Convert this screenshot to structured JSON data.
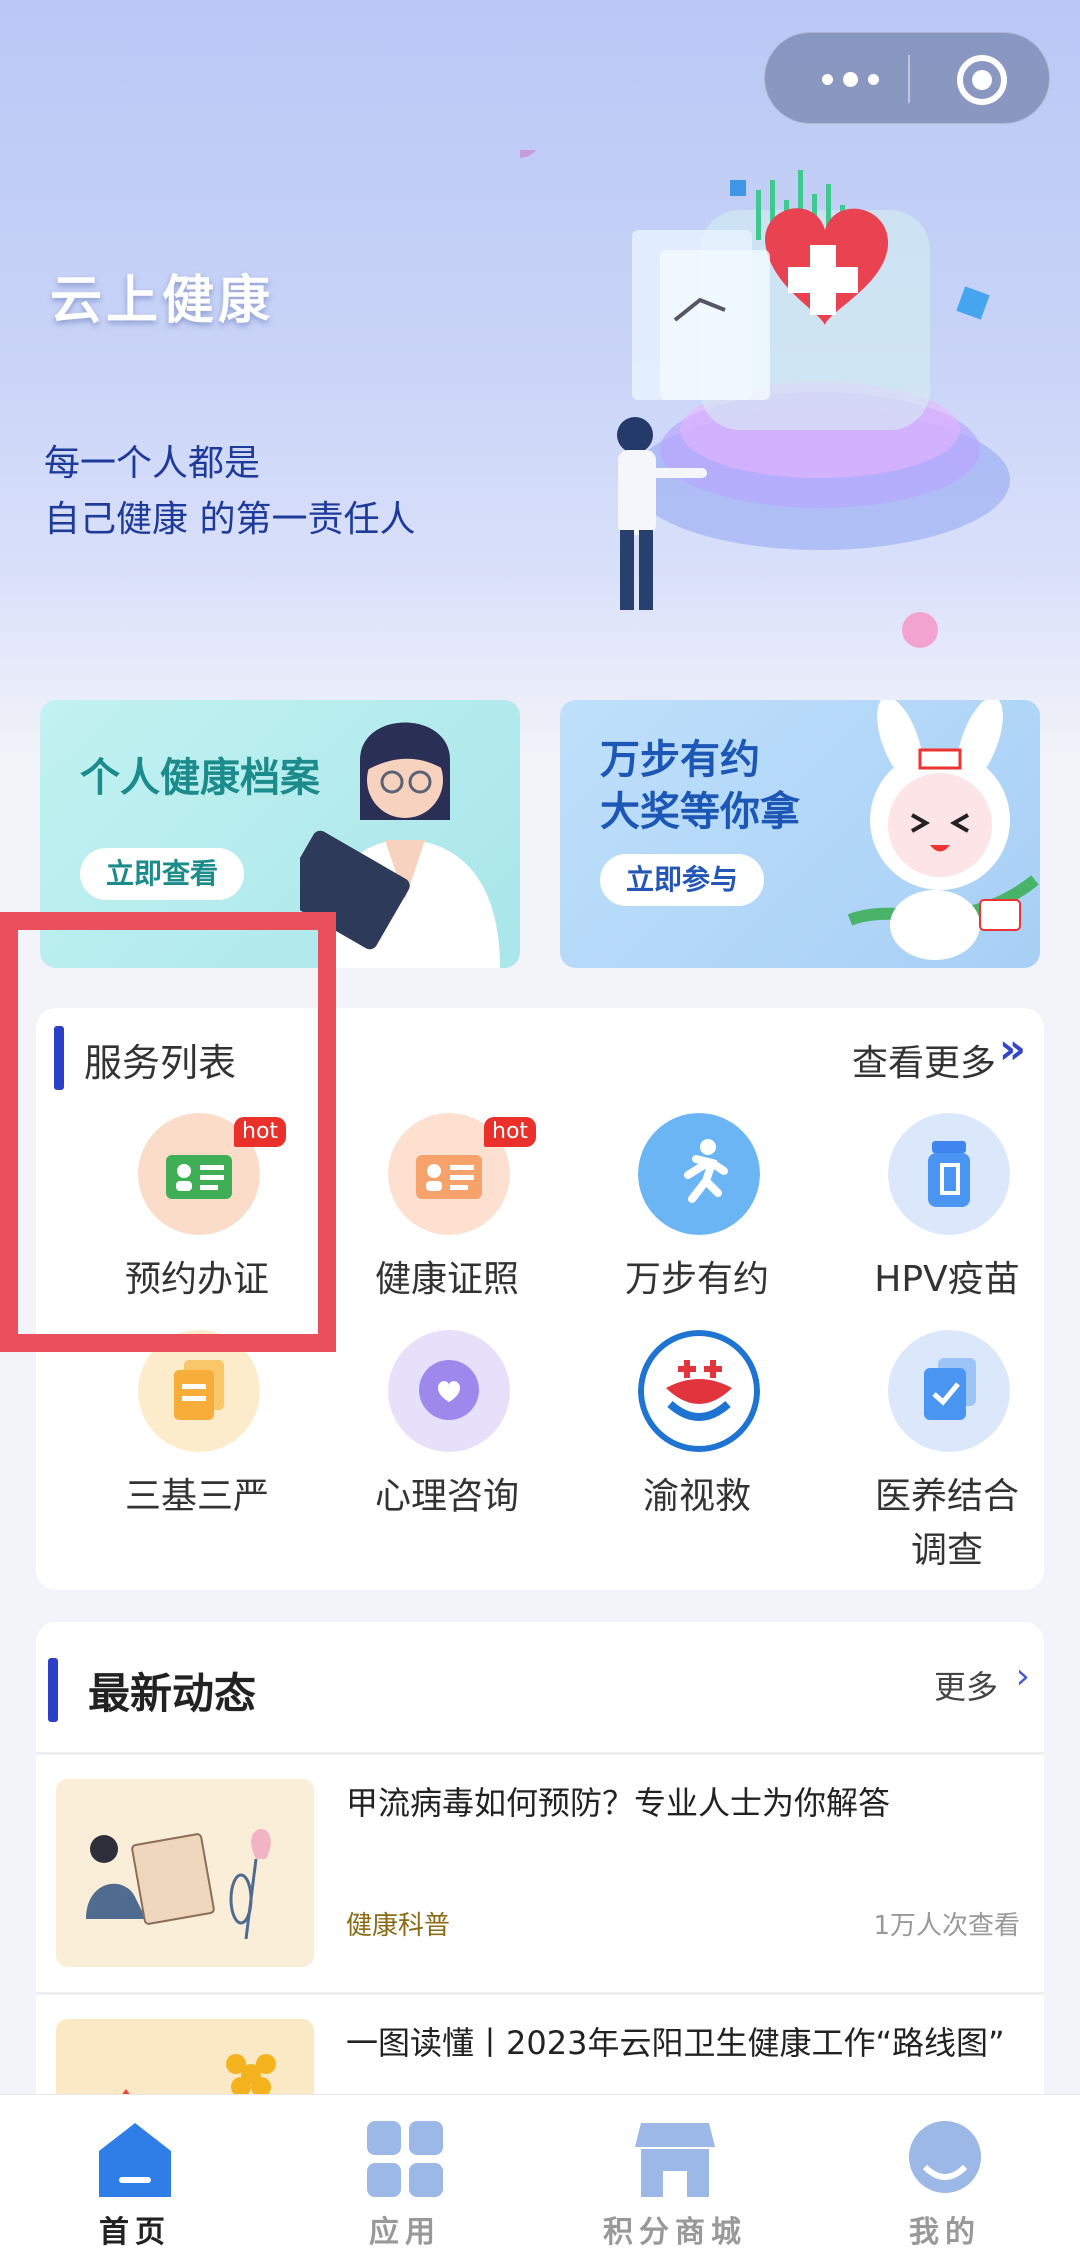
{
  "hero": {
    "title": "云上健康",
    "slogan_line1": "每一个人都是",
    "slogan_line2": "自己健康 的第一责任人"
  },
  "banners": [
    {
      "title_line1": "个人健康档案",
      "title_line2": "",
      "button": "立即查看"
    },
    {
      "title_line1": "万步有约",
      "title_line2": "大奖等你拿",
      "button": "立即参与"
    }
  ],
  "services": {
    "title": "服务列表",
    "more": "查看更多",
    "items": [
      {
        "label": "预约办证",
        "badge": "hot",
        "icon": "id-card-icon"
      },
      {
        "label": "健康证照",
        "badge": "hot",
        "icon": "certificate-icon"
      },
      {
        "label": "万步有约",
        "badge": "",
        "icon": "running-icon"
      },
      {
        "label": "HPV疫苗",
        "badge": "",
        "icon": "vaccine-bottle-icon"
      },
      {
        "label": "三基三严",
        "badge": "",
        "icon": "documents-icon"
      },
      {
        "label": "心理咨询",
        "badge": "",
        "icon": "heart-chat-icon"
      },
      {
        "label": "渝视救",
        "badge": "",
        "icon": "rescue-logo-icon"
      },
      {
        "label": "医养结合\n调查",
        "badge": "",
        "icon": "survey-check-icon"
      }
    ]
  },
  "news": {
    "title": "最新动态",
    "more": "更多",
    "items": [
      {
        "title": "甲流病毒如何预防？专业人士为你解答",
        "tag": "健康科普",
        "views": "1万人次查看"
      },
      {
        "title": "一图读懂丨2023年云阳卫生健康工作“路线图”",
        "tag": "",
        "views": ""
      }
    ]
  },
  "tabbar": [
    {
      "label": "首页",
      "icon": "home-icon",
      "active": true
    },
    {
      "label": "应用",
      "icon": "apps-grid-icon",
      "active": false
    },
    {
      "label": "积分商城",
      "icon": "store-icon",
      "active": false
    },
    {
      "label": "我的",
      "icon": "profile-icon",
      "active": false
    }
  ],
  "colors": {
    "accent": "#2b3fc7",
    "hot": "#e9302b",
    "highlight_box": "#e9505b"
  }
}
